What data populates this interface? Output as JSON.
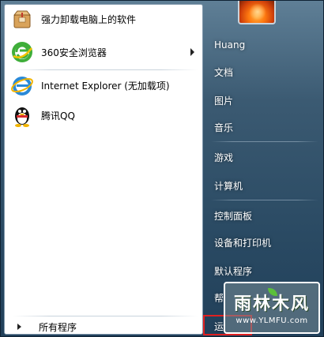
{
  "left_pane": {
    "programs": [
      {
        "label": "强力卸载电脑上的软件",
        "icon": "uninstaller-box-icon"
      },
      {
        "label": "360安全浏览器",
        "icon": "360-browser-icon",
        "has_submenu": true
      },
      {
        "label": "Internet Explorer (无加载项)",
        "icon": "internet-explorer-icon"
      },
      {
        "label": "腾讯QQ",
        "icon": "qq-penguin-icon"
      }
    ],
    "all_programs_label": "所有程序"
  },
  "right_pane": {
    "user_name": "Huang",
    "items": [
      "文档",
      "图片",
      "音乐",
      "游戏",
      "计算机",
      "控制面板",
      "设备和打印机",
      "默认程序",
      "帮",
      "运"
    ]
  },
  "watermark": {
    "title": "雨林木风",
    "url": "www.YLMFU.com"
  },
  "colors": {
    "left_pane_bg": "#ffffff",
    "right_pane_bg": "#2a4a63",
    "highlight_box": "#e02020"
  }
}
